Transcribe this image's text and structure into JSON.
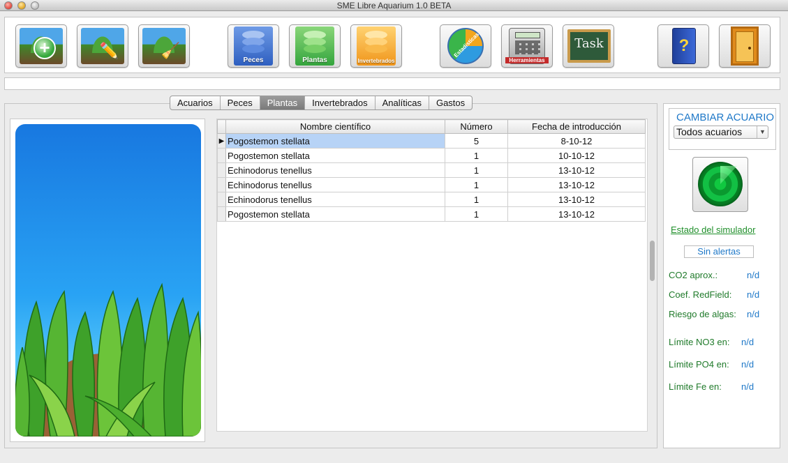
{
  "window": {
    "title": "SME Libre Aquarium 1.0 BETA"
  },
  "toolbar": {
    "buttons": [
      {
        "name": "add-aquarium",
        "icon": "aquarium-add-icon"
      },
      {
        "name": "edit-aquarium",
        "icon": "aquarium-edit-icon"
      },
      {
        "name": "clean-aquarium",
        "icon": "aquarium-clean-icon"
      },
      {
        "name": "peces",
        "icon": "database-icon",
        "label": "Peces",
        "color": "#3a6fd0"
      },
      {
        "name": "plantas",
        "icon": "database-icon",
        "label": "Plantas",
        "color": "#3db44a"
      },
      {
        "name": "invertebrados",
        "icon": "database-icon",
        "label": "Invertebrados",
        "color": "#f2a31c"
      },
      {
        "name": "estadisticas",
        "icon": "pie-chart-icon",
        "label": "Estadisticas"
      },
      {
        "name": "herramientas",
        "icon": "calculator-icon",
        "label": "Herramientas"
      },
      {
        "name": "task",
        "icon": "chalkboard-icon",
        "label": "Task"
      },
      {
        "name": "help",
        "icon": "help-book-icon",
        "label": "?"
      },
      {
        "name": "exit",
        "icon": "door-exit-icon"
      }
    ]
  },
  "tabs": [
    "Acuarios",
    "Peces",
    "Plantas",
    "Invertebrados",
    "Analíticas",
    "Gastos"
  ],
  "active_tab": "Plantas",
  "table": {
    "columns": [
      "Nombre científico",
      "Número",
      "Fecha de introducción"
    ],
    "rows": [
      {
        "name": "Pogostemon stellata",
        "num": "5",
        "date": "8-10-12",
        "selected": true
      },
      {
        "name": "Pogostemon stellata",
        "num": "1",
        "date": "10-10-12"
      },
      {
        "name": "Echinodorus tenellus",
        "num": "1",
        "date": "13-10-12"
      },
      {
        "name": "Echinodorus tenellus",
        "num": "1",
        "date": "13-10-12"
      },
      {
        "name": "Echinodorus tenellus",
        "num": "1",
        "date": "13-10-12"
      },
      {
        "name": "Pogostemon stellata",
        "num": "1",
        "date": "13-10-12"
      }
    ]
  },
  "side": {
    "cambiar_title": "CAMBIAR ACUARIO",
    "select_value": "Todos acuarios",
    "estado_link": "Estado del simulador",
    "alert_label": "Sin alertas",
    "stats": [
      {
        "label": "CO2 aprox.:",
        "value": "n/d"
      },
      {
        "label": "Coef. RedField:",
        "value": "n/d"
      },
      {
        "label": "Riesgo de algas:",
        "value": "n/d"
      },
      {
        "label": "Límite NO3 en:",
        "value": "n/d"
      },
      {
        "label": "Límite PO4 en:",
        "value": "n/d"
      },
      {
        "label": "Límite Fe en:",
        "value": "n/d"
      }
    ]
  },
  "colors": {
    "accent": "#1e78c8",
    "green_text": "#1f7a2a",
    "selection": "#b7d3f6"
  }
}
